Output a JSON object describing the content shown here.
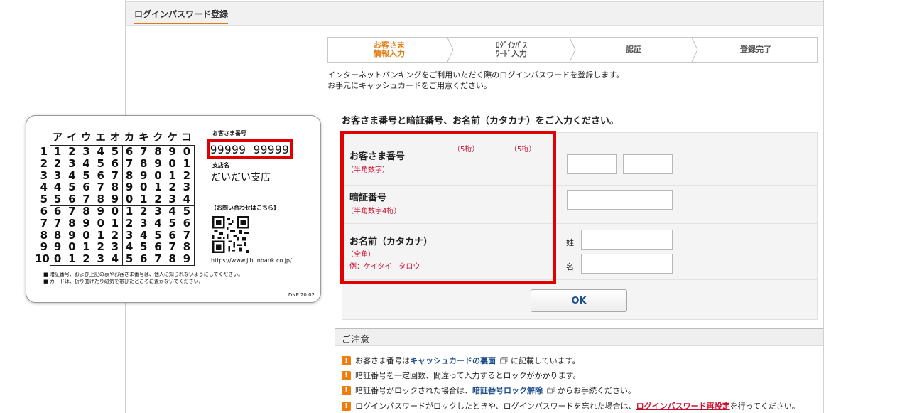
{
  "header": {
    "title": "ログインパスワード登録"
  },
  "steps": [
    {
      "line1": "お客さま",
      "line2": "情報入力",
      "active": true
    },
    {
      "line1": "ﾛｸﾞｲﾝﾊﾟｽ",
      "line2": "ﾜｰﾄﾞ入力",
      "active": false
    },
    {
      "line1": "認証",
      "line2": "",
      "active": false
    },
    {
      "line1": "登録完了",
      "line2": "",
      "active": false
    }
  ],
  "intro": {
    "line1": "インターネットバンキングをご利用いただく際のログインパスワードを登録します。",
    "line2": "お手元にキャッシュカードをご用意ください。"
  },
  "form": {
    "heading": "お客さま番号と暗証番号、お名前（カタカナ）をご入力ください。",
    "customer_no": {
      "label": "お客さま番号",
      "hint": "（半角数字）",
      "digits1": "（5桁）",
      "digits2": "（5桁）"
    },
    "pin": {
      "label": "暗証番号",
      "hint": "（半角数字4桁）"
    },
    "name": {
      "label": "お名前（カタカナ）",
      "hint": "（全角）",
      "example": "例：ケイタイ　タロウ",
      "sei": "姓",
      "mei": "名"
    },
    "ok_label": "OK"
  },
  "notes": {
    "title": "ご注意",
    "items": [
      {
        "pre": "お客さま番号は",
        "link": "キャッシュカードの裏面",
        "post": "に記載しています。"
      },
      {
        "pre": "暗証番号を一定回数、間違って入力するとロックがかかります。",
        "link": "",
        "post": ""
      },
      {
        "pre": "暗証番号がロックされた場合は、",
        "link": "暗証番号ロック解除",
        "post": "からお手続ください。"
      },
      {
        "pre": "ログインパスワードがロックしたときや、ログインパスワードを忘れた場合は、",
        "link": "ログインパスワード再設定",
        "post": "を行ってください。"
      }
    ]
  },
  "card": {
    "kana": [
      "ア",
      "イ",
      "ウ",
      "エ",
      "オ",
      "カ",
      "キ",
      "ク",
      "ケ",
      "コ"
    ],
    "rows": [
      "1234567890",
      "2345678901",
      "3456789012",
      "4567890123",
      "5678901234",
      "6789012345",
      "7890123456",
      "8901234567",
      "9012345678",
      "0123456789"
    ],
    "row_labels": [
      "1",
      "2",
      "3",
      "4",
      "5",
      "6",
      "7",
      "8",
      "9",
      "10"
    ],
    "customer_no_caption": "お客さま番号",
    "customer_no": "99999 99999",
    "branch_caption": "支店名",
    "branch": "だいだい支店",
    "contact": "【お問い合わせはこちら】",
    "url": "https://www.jibunbank.co.jp/",
    "fine1": "■ 暗証番号、および上記の表やお客さま番号は、他人に知られないようにしてください。",
    "fine2": "■ カードは、折り曲げたり磁気を帯びたところに置かないでください。",
    "dnp": "DNP 20.02"
  },
  "colors": {
    "accent": "#e07a10",
    "highlight": "#e00000",
    "link": "#1e4f8c",
    "hint": "#cc1133"
  }
}
